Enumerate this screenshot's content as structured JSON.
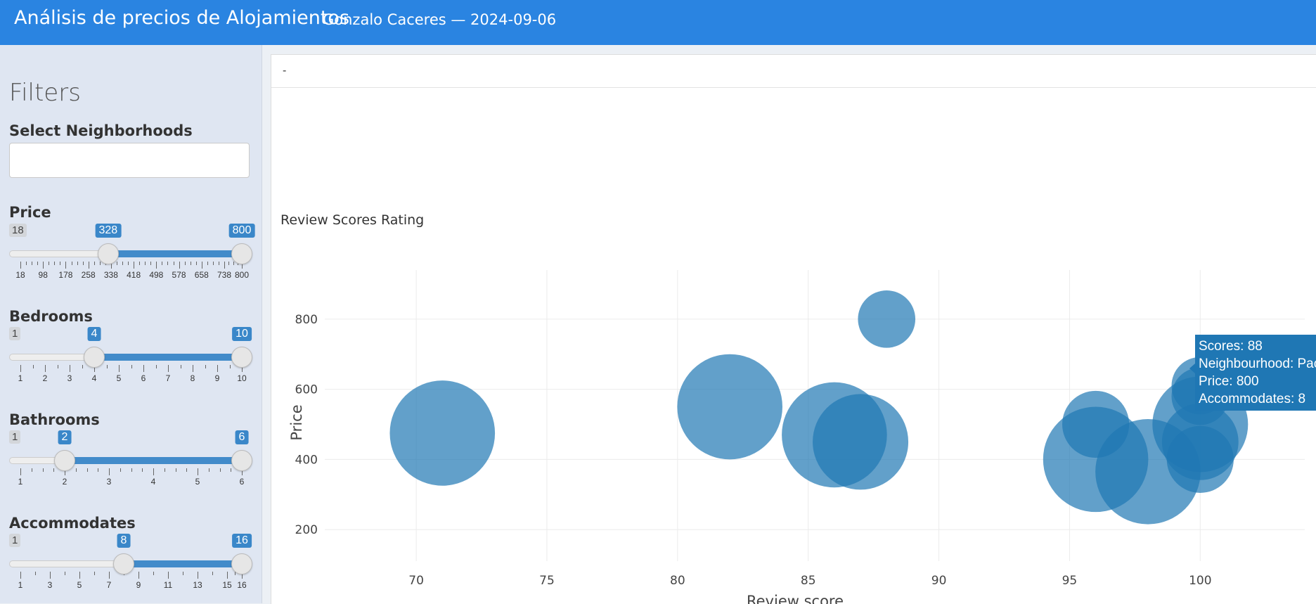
{
  "header": {
    "title": "Análisis de precios de Alojamientos",
    "subtitle": "Gonzalo Caceres — 2024-09-06"
  },
  "sidebar": {
    "title": "Filters",
    "neighborhoods_label": "Select Neighborhoods",
    "neighborhoods_value": "",
    "sliders": [
      {
        "label": "Price",
        "min": 18,
        "max": 800,
        "from": 328,
        "to": 800,
        "ticks": [
          "18",
          "98",
          "178",
          "258",
          "338",
          "418",
          "498",
          "578",
          "658",
          "738",
          "800"
        ]
      },
      {
        "label": "Bedrooms",
        "min": 1,
        "max": 10,
        "from": 4,
        "to": 10,
        "ticks": [
          "1",
          "2",
          "3",
          "4",
          "5",
          "6",
          "7",
          "8",
          "9",
          "10"
        ]
      },
      {
        "label": "Bathrooms",
        "min": 1,
        "max": 6,
        "from": 2,
        "to": 6,
        "ticks": [
          "1",
          "2",
          "3",
          "4",
          "5",
          "6"
        ]
      },
      {
        "label": "Accommodates",
        "min": 1,
        "max": 16,
        "from": 8,
        "to": 16,
        "ticks": [
          "1",
          "3",
          "5",
          "7",
          "9",
          "11",
          "13",
          "15",
          "16"
        ]
      }
    ]
  },
  "main": {
    "header_text": "-"
  },
  "chart_data": {
    "type": "scatter",
    "title": "Review Scores Rating",
    "xlabel": "Review score",
    "ylabel": "Price",
    "xlim": [
      66.5,
      104
    ],
    "ylim": [
      110,
      940
    ],
    "xticks": [
      70,
      75,
      80,
      85,
      90,
      95,
      100
    ],
    "yticks": [
      200,
      400,
      600,
      800
    ],
    "grid": true,
    "color": "#1f77b4",
    "points": [
      {
        "x": 71,
        "y": 475,
        "size": 11
      },
      {
        "x": 82,
        "y": 550,
        "size": 11
      },
      {
        "x": 86,
        "y": 470,
        "size": 11
      },
      {
        "x": 87,
        "y": 450,
        "size": 10
      },
      {
        "x": 88,
        "y": 800,
        "size": 6
      },
      {
        "x": 96,
        "y": 500,
        "size": 7
      },
      {
        "x": 96,
        "y": 400,
        "size": 11
      },
      {
        "x": 98,
        "y": 365,
        "size": 11
      },
      {
        "x": 100,
        "y": 610,
        "size": 6
      },
      {
        "x": 100,
        "y": 580,
        "size": 6
      },
      {
        "x": 100,
        "y": 500,
        "size": 10
      },
      {
        "x": 100,
        "y": 450,
        "size": 8
      },
      {
        "x": 100,
        "y": 400,
        "size": 7
      }
    ],
    "tooltip": {
      "scores": "Scores:  88",
      "neighbourhood": "Neighbourhood:  Pacifico",
      "price": "Price:  800",
      "accommodates": "Accommodates:  8"
    }
  }
}
